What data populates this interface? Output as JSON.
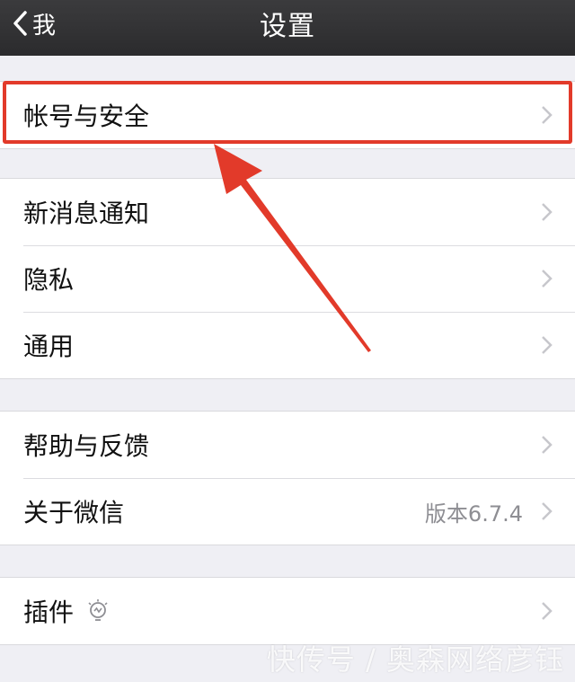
{
  "navbar": {
    "back_label": "我",
    "title": "设置"
  },
  "groups": [
    {
      "items": [
        {
          "label": "帐号与安全"
        }
      ]
    },
    {
      "items": [
        {
          "label": "新消息通知"
        },
        {
          "label": "隐私"
        },
        {
          "label": "通用"
        }
      ]
    },
    {
      "items": [
        {
          "label": "帮助与反馈"
        },
        {
          "label": "关于微信",
          "detail": "版本6.7.4"
        }
      ]
    },
    {
      "items": [
        {
          "label": "插件",
          "icon": "lightbulb-icon"
        }
      ]
    }
  ],
  "watermark": "快传号 / 奥森网络彦钰",
  "colors": {
    "navbar_bg": "#2f2f31",
    "page_bg": "#efeff4",
    "highlight": "#e23a2a",
    "chevron": "#c7c7cc",
    "detail_text": "#8e8e93"
  }
}
